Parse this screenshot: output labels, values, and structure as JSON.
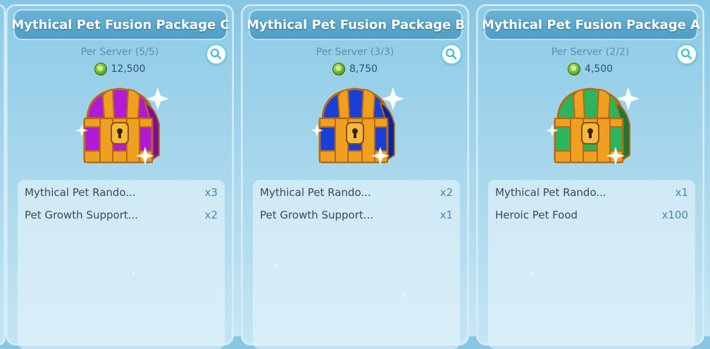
{
  "cards": [
    {
      "title": "Mythical Pet Fusion Package C",
      "per_server": "Per Server (5/5)",
      "price": "12,500",
      "chest_color": "#b21ad6",
      "chest_dark": "#7b0ea0",
      "items": [
        {
          "name": "Mythical Pet Rando...",
          "qty": "x3"
        },
        {
          "name": "Pet Growth Support...",
          "qty": "x2"
        }
      ]
    },
    {
      "title": "Mythical Pet Fusion Package B",
      "per_server": "Per Server (3/3)",
      "price": "8,750",
      "chest_color": "#1a3fd6",
      "chest_dark": "#0c2596",
      "items": [
        {
          "name": "Mythical Pet Rando...",
          "qty": "x2"
        },
        {
          "name": "Pet Growth Support...",
          "qty": "x1"
        }
      ]
    },
    {
      "title": "Mythical Pet Fusion Package A",
      "per_server": "Per Server (2/2)",
      "price": "4,500",
      "chest_color": "#2bb560",
      "chest_dark": "#167a3c",
      "items": [
        {
          "name": "Mythical Pet Rando...",
          "qty": "x1"
        },
        {
          "name": "Heroic Pet Food",
          "qty": "x100"
        }
      ]
    }
  ],
  "icons": {
    "currency": "green-coin-icon",
    "zoom": "magnifier-icon",
    "chest": "treasure-chest-icon"
  },
  "colors": {
    "title_bg": "#4f9ec6",
    "zoom_ring": "#6ad0d8",
    "chest_gold": "#f0a020"
  }
}
